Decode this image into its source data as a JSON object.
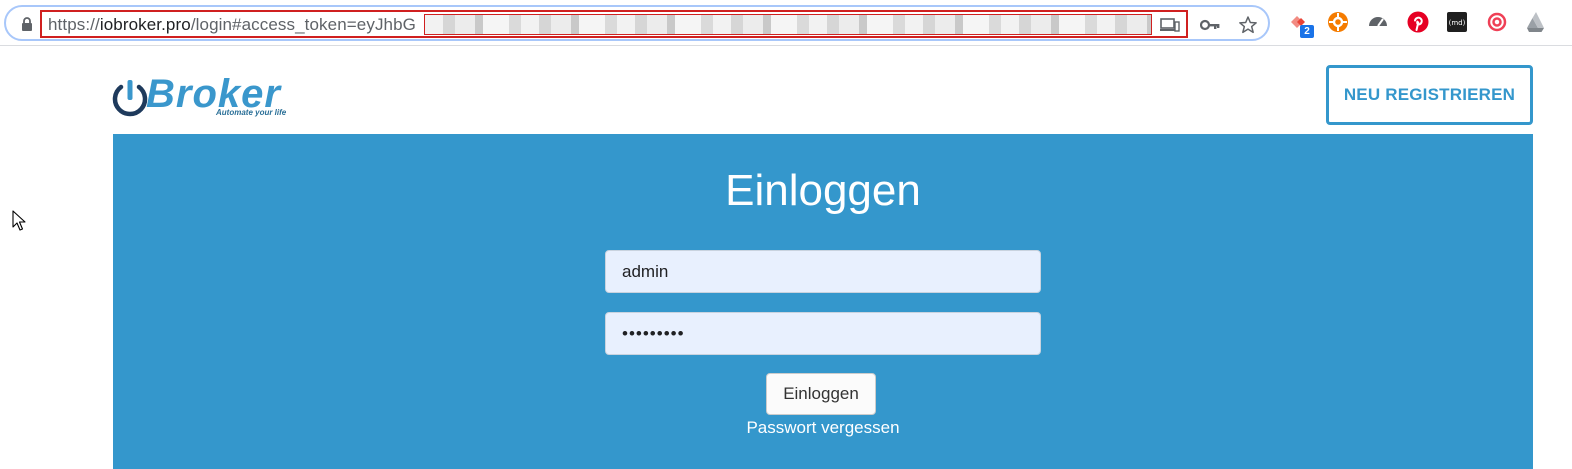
{
  "browser": {
    "url_scheme": "https://",
    "url_host": "iobroker.pro",
    "url_path": "/login#access_token=eyJhbG",
    "extension_badge": "2"
  },
  "header": {
    "logo_text": "Broker",
    "logo_tagline": "Automate your life",
    "register_label": "NEU REGISTRIEREN"
  },
  "login": {
    "title": "Einloggen",
    "username_value": "admin",
    "password_masked": "•••••••••",
    "submit_label": "Einloggen",
    "forgot_label": "Passwort vergessen"
  },
  "colors": {
    "brand_blue": "#3497cc",
    "field_bg": "#e8f0fe",
    "highlight_red": "#d02020"
  },
  "icons": [
    "lock-icon",
    "devices-icon",
    "key-icon",
    "star-icon",
    "gear-icon",
    "pinterest-icon",
    "md-icon",
    "pocket-icon",
    "drive-icon",
    "cursor-icon"
  ]
}
